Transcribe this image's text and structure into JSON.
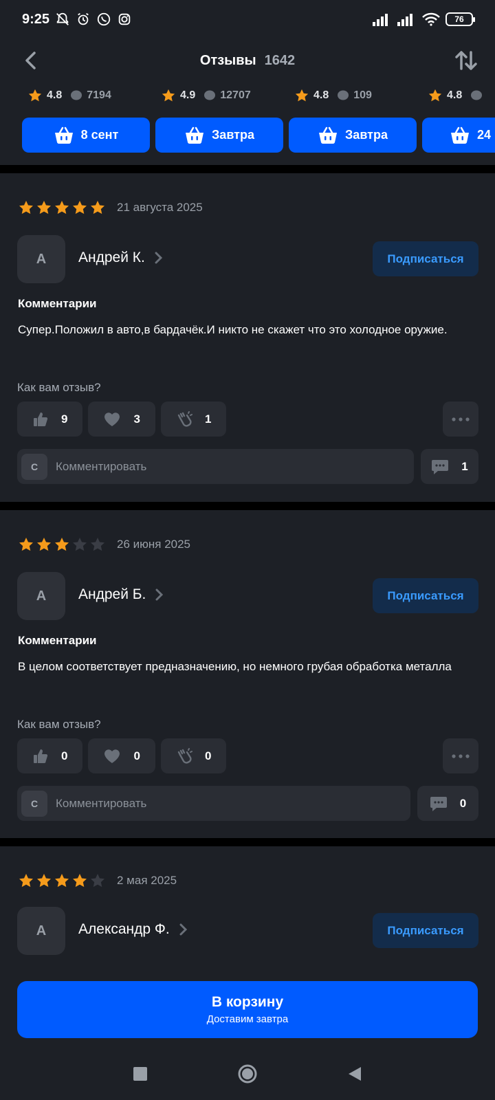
{
  "status": {
    "time": "9:25",
    "battery": "76"
  },
  "header": {
    "title": "Отзывы",
    "count": "1642"
  },
  "offers": [
    {
      "rating": "4.8",
      "reviews": "7194",
      "delivery": "8 сент"
    },
    {
      "rating": "4.9",
      "reviews": "12707",
      "delivery": "Завтра"
    },
    {
      "rating": "4.8",
      "reviews": "109",
      "delivery": "Завтра"
    },
    {
      "rating": "4.8",
      "reviews": "",
      "delivery": "24"
    }
  ],
  "reviews": [
    {
      "rating": 5,
      "date": "21 августа 2025",
      "avatar_letter": "А",
      "author": "Андрей К.",
      "subscribe": "Подписаться",
      "comment_heading": "Комментарии",
      "comment": "Супер.Положил в авто,в бардачёк.И никто не скажет что это холодное оружие.",
      "question": "Как вам отзыв?",
      "likes": "9",
      "hearts": "3",
      "claps": "1",
      "input_avatar": "С",
      "input_placeholder": "Комментировать",
      "comments_count": "1"
    },
    {
      "rating": 3,
      "date": "26 июня 2025",
      "avatar_letter": "А",
      "author": "Андрей Б.",
      "subscribe": "Подписаться",
      "comment_heading": "Комментарии",
      "comment": "В целом соответствует предназначению, но немного грубая обработка металла",
      "question": "Как вам отзыв?",
      "likes": "0",
      "hearts": "0",
      "claps": "0",
      "input_avatar": "С",
      "input_placeholder": "Комментировать",
      "comments_count": "0"
    },
    {
      "rating": 4,
      "date": "2 мая 2025",
      "avatar_letter": "А",
      "author": "Александр Ф.",
      "subscribe": "Подписаться"
    }
  ],
  "cart": {
    "title": "В корзину",
    "subtitle": "Доставим завтра"
  },
  "colors": {
    "accent": "#005bff",
    "star": "#f59b1b",
    "background": "#1d2026"
  }
}
